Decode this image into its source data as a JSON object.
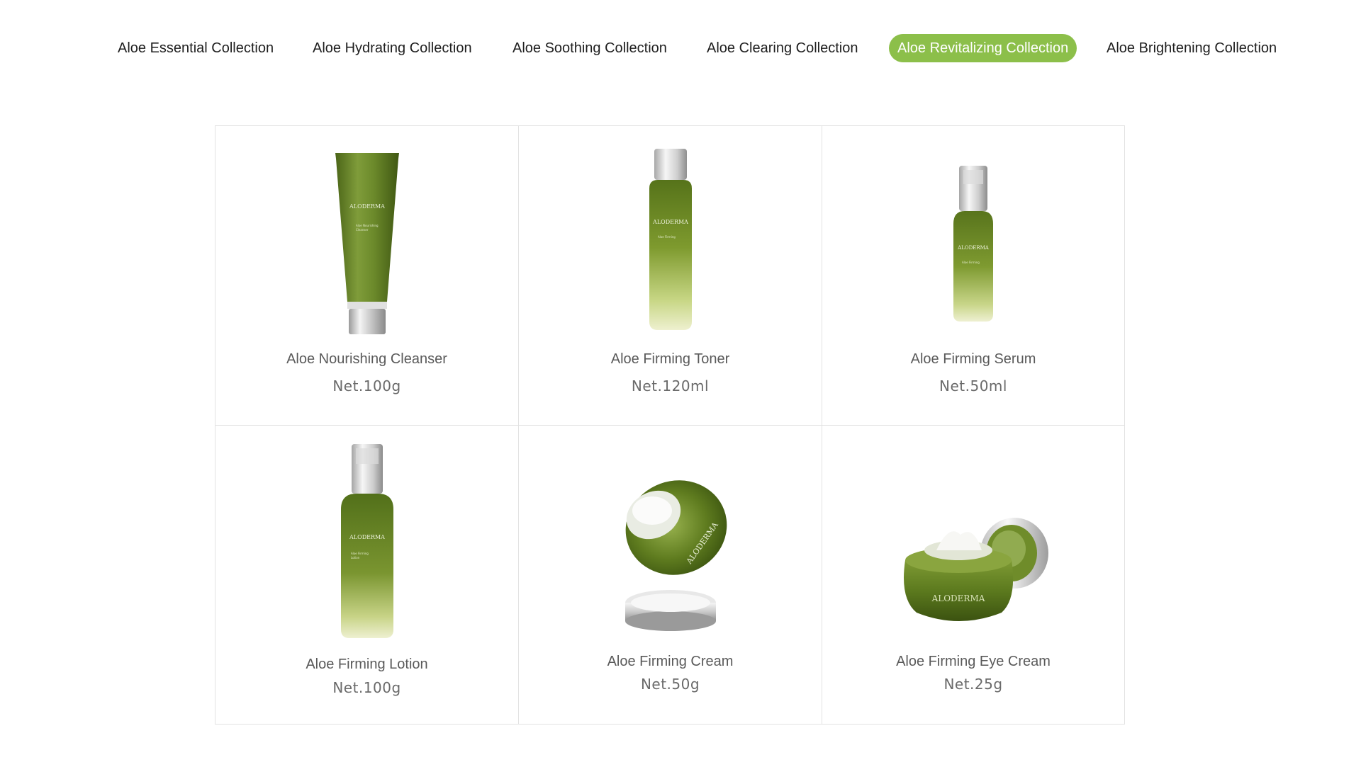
{
  "tabs": [
    {
      "label": "Aloe Essential Collection",
      "active": false
    },
    {
      "label": "Aloe Hydrating Collection",
      "active": false
    },
    {
      "label": "Aloe Soothing Collection",
      "active": false
    },
    {
      "label": "Aloe Clearing Collection",
      "active": false
    },
    {
      "label": "Aloe Revitalizing Collection",
      "active": true
    },
    {
      "label": "Aloe Brightening Collection",
      "active": false
    }
  ],
  "colors": {
    "accent": "#8cbf4a",
    "border": "#e2e2e2",
    "product_green": "#5d7a22"
  },
  "brand": "ALODERMA",
  "products": [
    {
      "name": "Aloe Nourishing Cleanser",
      "net": "Net.100g",
      "icon": "tube"
    },
    {
      "name": "Aloe Firming Toner",
      "net": "Net.120ml",
      "icon": "bottle"
    },
    {
      "name": "Aloe Firming Serum",
      "net": "Net.50ml",
      "icon": "pump-bottle"
    },
    {
      "name": "Aloe Firming Lotion",
      "net": "Net.100g",
      "icon": "pump-bottle"
    },
    {
      "name": "Aloe Firming Cream",
      "net": "Net.50g",
      "icon": "cream-jar"
    },
    {
      "name": "Aloe Firming Eye Cream",
      "net": "Net.25g",
      "icon": "eye-cream-jar"
    }
  ]
}
